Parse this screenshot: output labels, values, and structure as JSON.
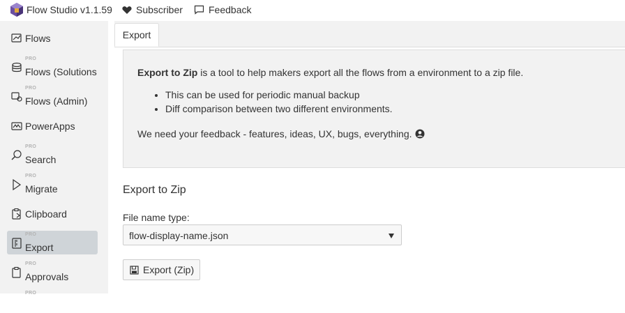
{
  "app": {
    "title": "Flow Studio v1.1.59",
    "subscriber_label": "Subscriber",
    "feedback_label": "Feedback"
  },
  "sidebar": {
    "pro_badge": "PRO",
    "items": [
      {
        "label": "Flows",
        "icon": "flows-icon",
        "pro": false
      },
      {
        "label": "Flows (Solutions",
        "icon": "solutions-icon",
        "pro": true
      },
      {
        "label": "Flows (Admin)",
        "icon": "admin-icon",
        "pro": true
      },
      {
        "label": "PowerApps",
        "icon": "powerapps-icon",
        "pro": false
      },
      {
        "label": "Search",
        "icon": "search-icon",
        "pro": true
      },
      {
        "label": "Migrate",
        "icon": "play-icon",
        "pro": true
      },
      {
        "label": "Clipboard",
        "icon": "clipboard-icon",
        "pro": false
      },
      {
        "label": "Export",
        "icon": "export-icon",
        "pro": true,
        "active": true
      },
      {
        "label": "Approvals",
        "icon": "approvals-icon",
        "pro": true
      }
    ]
  },
  "tabs": [
    {
      "label": "Export"
    }
  ],
  "info": {
    "intro_bold": "Export to Zip",
    "intro_rest": " is a tool to help makers export all the flows from a environment to a zip file.",
    "bullets": [
      "This can be used for periodic manual backup",
      "Diff comparison between two different environments."
    ],
    "feedback_text": "We need your feedback - features, ideas, UX, bugs, everything."
  },
  "form": {
    "section_title": "Export to Zip",
    "file_name_label": "File name type:",
    "file_name_value": "flow-display-name.json",
    "export_button": "Export (Zip)"
  },
  "colors": {
    "sidebar_bg": "#f2f2f2",
    "active_item_bg": "#cfd4d8",
    "logo_purple": "#6b4fa0"
  }
}
